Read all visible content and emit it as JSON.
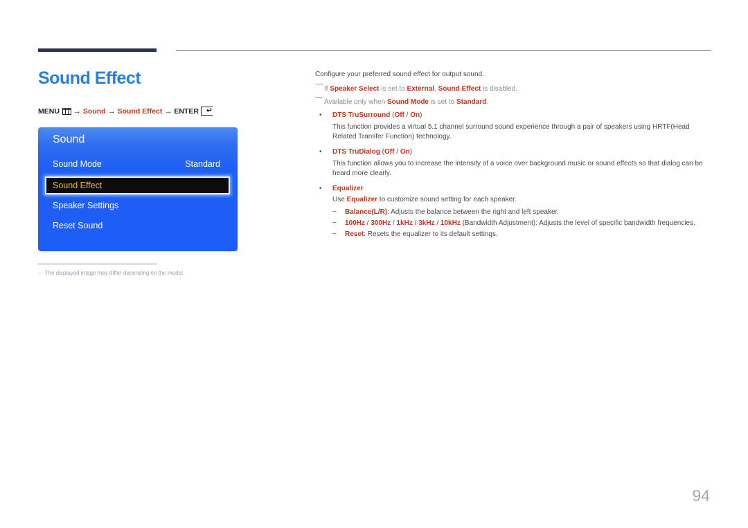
{
  "header": {
    "title": "Sound Effect"
  },
  "menu_path": {
    "menu": "MENU",
    "arrow": "→",
    "sound": "Sound",
    "sound_effect": "Sound Effect",
    "enter": "ENTER",
    "icons": [
      "menu-icon",
      "enter-icon"
    ]
  },
  "osd": {
    "title": "Sound",
    "items": [
      {
        "label": "Sound Mode",
        "value": "Standard"
      },
      {
        "label": "Sound Effect",
        "selected": true
      },
      {
        "label": "Speaker Settings"
      },
      {
        "label": "Reset Sound"
      }
    ],
    "colors": {
      "panel": "#1e5ef8",
      "selected_bg": "#0c0c0c",
      "selected_text": "#f0b92e"
    }
  },
  "content": {
    "intro": "Configure your preferred sound effect for output sound.",
    "note1": {
      "p1": "If ",
      "k1": "Speaker Select",
      "p2": " is set to ",
      "k2": "External",
      "p3": ", ",
      "k3": "Sound Effect",
      "p4": " is disabled."
    },
    "note2": {
      "p1": "Available only when ",
      "k1": "Sound Mode",
      "p2": " is set to ",
      "k2": "Standard",
      "p3": "."
    },
    "bullets": [
      {
        "name": "DTS TruSurround",
        "open": " (",
        "opt1": "Off",
        "sep": " / ",
        "opt2": "On",
        "close": ")",
        "desc1": "This function provides a virtual 5.1 channel surround sound experience through a pair of speakers using HRTF(Head",
        "desc2": "Related Transfer Function) technology."
      },
      {
        "name": "DTS TruDialog",
        "open": " (",
        "opt1": "Off",
        "sep": " / ",
        "opt2": "On",
        "close": ")",
        "desc1": "This function allows you to increase the intensity of a voice over background music or sound effects so that dialog can be",
        "desc2": "heard more clearly."
      },
      {
        "name": "Equalizer",
        "desc_p1": "Use ",
        "desc_k1": "Equalizer",
        "desc_p2": " to customize sound setting for each speaker."
      }
    ],
    "equalizer_items": [
      {
        "key": "Balance(L/R)",
        "text": ": Adjusts the balance between the right and left speaker."
      },
      {
        "k1": "100Hz",
        "k2": "300Hz",
        "k3": "1kHz",
        "k4": "3kHz",
        "k5": "10kHz",
        "sep": " / ",
        "text": " (Bandwidth Adjustment): Adjusts the level of specific bandwidth frequencies."
      },
      {
        "key": "Reset",
        "text": ": Resets the equalizer to its default settings."
      }
    ],
    "dash": "−",
    "bullet": "•"
  },
  "footnote": {
    "dash": "−",
    "text": "The displayed image may differ depending on the model."
  },
  "page_number": "94",
  "colors": {
    "title": "#2a7de1",
    "highlight": "#c8341a",
    "rule": "#2e3350"
  }
}
